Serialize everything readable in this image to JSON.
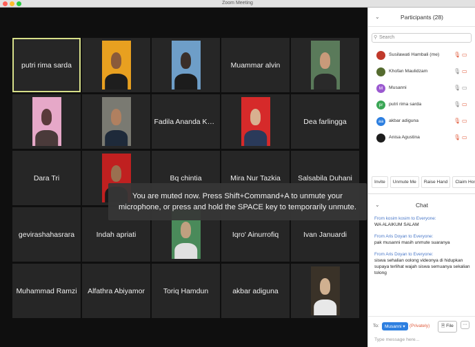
{
  "window": {
    "title": "Zoom Meeting"
  },
  "participants_panel": {
    "title": "Participants (28)",
    "search_placeholder": "Search",
    "items": [
      {
        "name": "Susilawati Hambali (me)",
        "avatar": "photo",
        "color": "#c0392b",
        "mic": "muted",
        "video": "off"
      },
      {
        "name": "Khofan Maulidzam",
        "avatar": "photo",
        "color": "#556b2f",
        "mic": "on",
        "video": "off"
      },
      {
        "name": "Musanni",
        "avatar": "M",
        "color": "#9b59d0",
        "mic": "on",
        "video": "on"
      },
      {
        "name": "putri rima sarda",
        "avatar": "pr",
        "color": "#3aa655",
        "mic": "on",
        "video": "off"
      },
      {
        "name": "akbar adiguna",
        "avatar": "aa",
        "color": "#2d7fe0",
        "mic": "muted",
        "video": "off"
      },
      {
        "name": "Anisa Agustina",
        "avatar": "photo",
        "color": "#1d1d1d",
        "mic": "muted",
        "video": "off"
      }
    ],
    "buttons": [
      "Invite",
      "Unmute Me",
      "Raise Hand",
      "Claim Host"
    ]
  },
  "chat": {
    "title": "Chat",
    "messages": [
      {
        "from_prefix": "From",
        "sender": "kosim kosim",
        "to": "to Everyone:",
        "text": "WA ALAIKUM SALAM"
      },
      {
        "from_prefix": "From",
        "sender": "Aris Doyan",
        "to": "to Everyone:",
        "text": "pak musanni masih unmute suaranya"
      },
      {
        "from_prefix": "From",
        "sender": "Aris Doyan",
        "to": "to Everyone:",
        "text": "siswa sehalian oolong videonya di hidupkan supaya terlihat wajah siswa semuanya sekalian tolong"
      }
    ],
    "to_label": "To:",
    "recipient": "Musanni",
    "privately": "(Privately)",
    "file_label": "File",
    "more_label": "···",
    "input_placeholder": "Type message here..."
  },
  "toast": {
    "text": "You are muted now. Press Shift+Command+A to unmute your microphone, or press and hold the SPACE key to temporarily unmute."
  },
  "tiles": [
    {
      "name": "putri rima sarda",
      "active": true
    },
    {
      "name": "",
      "photo": {
        "bg": "#e8a020",
        "skin": "#8a5a3a",
        "shirt": "#1e1e1e"
      }
    },
    {
      "name": "",
      "photo": {
        "bg": "#6e9ec8",
        "skin": "#3a2f2a",
        "shirt": "#1c1c1c"
      }
    },
    {
      "name": "Muammar alvin"
    },
    {
      "name": "",
      "photo": {
        "bg": "#5a7a5a",
        "skin": "#c89a7a",
        "shirt": "#2a2a2a"
      }
    },
    {
      "name": "",
      "photo": {
        "bg": "#e6a8c8",
        "skin": "#5a3a3a",
        "shirt": "#4a3a3a"
      }
    },
    {
      "name": "",
      "photo": {
        "bg": "#7a7a72",
        "skin": "#b08060",
        "shirt": "#1e2a3a"
      }
    },
    {
      "name": "Fadila Ananda Karti..."
    },
    {
      "name": "",
      "photo": {
        "bg": "#d62a2a",
        "skin": "#d8b090",
        "shirt": "#2a3a5a"
      }
    },
    {
      "name": "Dea farlingga"
    },
    {
      "name": "Dara Tri"
    },
    {
      "name": "",
      "photo": {
        "bg": "#c02020",
        "skin": "#9a7050",
        "shirt": "#1a1a1a"
      }
    },
    {
      "name": "Bq chintia"
    },
    {
      "name": "Mira Nur Tazkia"
    },
    {
      "name": "Salsabila Duhani"
    },
    {
      "name": "gevirashahasrara"
    },
    {
      "name": "Indah apriati"
    },
    {
      "name": "",
      "photo": {
        "bg": "#4a8a5a",
        "skin": "#c0a080",
        "shirt": "#e0e0e0"
      }
    },
    {
      "name": "Iqro' Ainurrofiq"
    },
    {
      "name": "Ivan Januardi"
    },
    {
      "name": "Muhammad Ramzi"
    },
    {
      "name": "Alfathra Abiyamor"
    },
    {
      "name": "Toriq Hamdun"
    },
    {
      "name": "akbar adiguna"
    },
    {
      "name": "",
      "photo": {
        "bg": "#3a3228",
        "skin": "#d0b090",
        "shirt": "#e8e8e8"
      }
    }
  ],
  "colors": {
    "accent": "#2d7fe0",
    "muted_icon": "#e05a3a",
    "active_outline": "#d8e08a",
    "window_dot_red": "#ff5f57",
    "window_dot_yellow": "#febc2e",
    "window_dot_green": "#28c840"
  }
}
